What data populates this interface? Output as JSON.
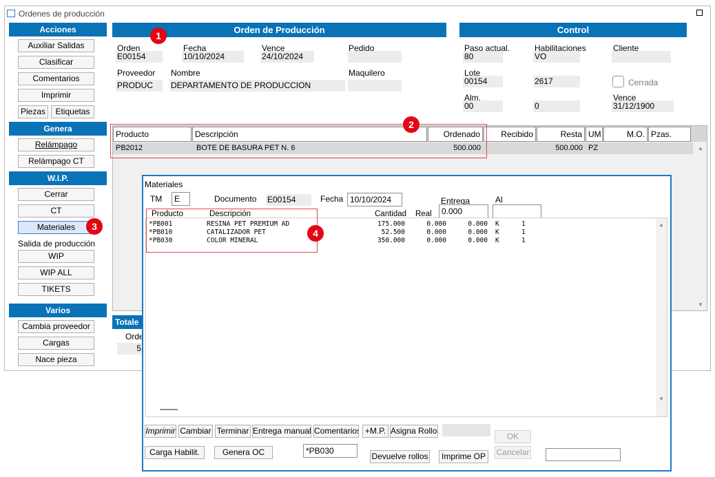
{
  "window": {
    "title": "Ordenes de producción"
  },
  "sidebar": {
    "acciones_header": "Acciones",
    "auxiliar_salidas": "Auxiliar Salidas",
    "clasificar": "Clasificar",
    "comentarios": "Comentarios",
    "imprimir": "Imprimir",
    "piezas": "Piezas",
    "etiquetas": "Etiquetas",
    "genera_header": "Genera",
    "relampago": "Relámpago",
    "relampago_ct": "Relámpago CT",
    "wip_header": "W.I.P.",
    "cerrar": "Cerrar",
    "ct": "CT",
    "materiales": "Materiales",
    "salida_produccion": "Salida de producción",
    "wip": "WIP",
    "wip_all": "WIP ALL",
    "tikets": "TIKETS",
    "varios_header": "Varios",
    "cambia_proveedor": "Cambia proveedor",
    "cargas": "Cargas",
    "nace_pieza": "Nace pieza"
  },
  "order": {
    "header": "Orden de Producción",
    "orden_label": "Orden",
    "orden_value": "E00154",
    "fecha_label": "Fecha",
    "fecha_value": "10/10/2024",
    "vence_label": "Vence",
    "vence_value": "24/10/2024",
    "pedido_label": "Pedido",
    "pedido_value": "",
    "proveedor_label": "Proveedor",
    "proveedor_value": "PRODUC",
    "nombre_label": "Nombre",
    "nombre_value": "DEPARTAMENTO DE PRODUCCION",
    "maquilero_label": "Maquilero",
    "maquilero_value": ""
  },
  "control": {
    "header": "Control",
    "paso_label": "Paso actual.",
    "paso_value": "80",
    "habilitaciones_label": "Habilitaciones",
    "habilitaciones_value": "VO",
    "cliente_label": "Cliente",
    "cliente_value": "",
    "lote_label": "Lote",
    "lote_value": "00154",
    "lote_value2": "2617",
    "cerrada_label": "Cerrada",
    "alm_label": "Alm.",
    "alm_value": "00",
    "alm_value2": "0",
    "vence_label": "Vence",
    "vence_value": "31/12/1900"
  },
  "grid": {
    "columns": [
      "Producto",
      "Descripción",
      "Ordenado",
      "Recibido",
      "Resta",
      "UM",
      "M.O.",
      "Pzas."
    ],
    "row": {
      "producto": "PB2012",
      "descripcion": "BOTE DE BASURA PET N. 6",
      "ordenado": "500.000",
      "recibido": "",
      "resta": "500.000",
      "um": "PZ",
      "mo": "",
      "pzas": ""
    }
  },
  "totals": {
    "header": "Totale",
    "orden_label": "Orde",
    "value": "5"
  },
  "materiales": {
    "title": "Materiales",
    "tm_label": "TM",
    "tm_value": "E",
    "documento_label": "Documento",
    "documento_value": "E00154",
    "fecha_label": "Fecha",
    "fecha_value": "10/10/2024",
    "entrega_label": "Entrega",
    "entrega_value": "0.000",
    "al_label": "Al",
    "al_value": "",
    "columns": {
      "producto": "Producto",
      "descripcion": "Descripción",
      "cantidad": "Cantidad",
      "real": "Real"
    },
    "rows": [
      {
        "producto": "*PB001",
        "descripcion": "RESINA PET PREMIUM AD",
        "cantidad": "175.000",
        "real": "0.000",
        "extra": "0.000",
        "um": "K",
        "n": "1"
      },
      {
        "producto": "*PB010",
        "descripcion": "CATALIZADOR PET",
        "cantidad": "52.500",
        "real": "0.000",
        "extra": "0.000",
        "um": "K",
        "n": "1"
      },
      {
        "producto": "*PB030",
        "descripcion": "COLOR MINERAL",
        "cantidad": "350.000",
        "real": "0.000",
        "extra": "0.000",
        "um": "K",
        "n": "1"
      }
    ],
    "buttons": {
      "imprimir": "Imprimir",
      "cambiar": "Cambiar",
      "terminar": "Terminar",
      "entrega_manual": "Entrega manual",
      "comentarios": "Comentarios",
      "mas_mp": "+M.P.",
      "asigna_rollos": "Asigna Rollos",
      "ok": "OK",
      "carga_habilit": "Carga Habilit.",
      "genera_oc": "Genera OC",
      "devuelve_rollos": "Devuelve rollos",
      "imprime_op": "Imprime OP",
      "cancelar": "Cancelar"
    },
    "current_code": "*PB030"
  },
  "badges": [
    "1",
    "2",
    "3",
    "4"
  ]
}
